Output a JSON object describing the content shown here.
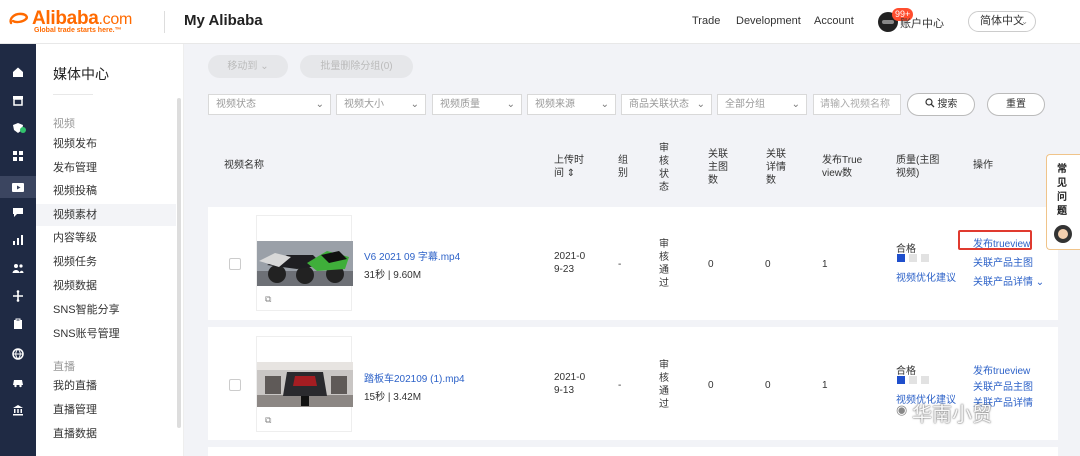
{
  "header": {
    "logo_text": "Alibaba",
    "logo_suffix": ".com",
    "logo_tagline": "Global trade starts here.™",
    "title": "My Alibaba",
    "nav": [
      "Trade",
      "Development",
      "Account"
    ],
    "notification_count": "99+",
    "user_center": "账户中心",
    "language": "简体中文"
  },
  "rail": {
    "icons": [
      "home-icon",
      "store-icon",
      "shield-icon",
      "grid-icon",
      "media-icon",
      "chat-icon",
      "chart-icon",
      "people-icon",
      "share-icon",
      "clipboard-icon",
      "globe-icon",
      "delivery-icon",
      "bank-icon"
    ]
  },
  "sidebar": {
    "title": "媒体中心",
    "group_video": "视频",
    "video_items": [
      "视频发布",
      "发布管理",
      "视频投稿",
      "视频素材",
      "内容等级",
      "视频任务",
      "视频数据",
      "SNS智能分享",
      "SNS账号管理"
    ],
    "group_live": "直播",
    "live_items": [
      "我的直播",
      "直播管理",
      "直播数据"
    ],
    "active_item": "视频素材"
  },
  "toolbar": {
    "move_to": "移动到",
    "batch_delete": "批量删除分组(0)",
    "filters": [
      "视频状态",
      "视频大小",
      "视频质量",
      "视频来源",
      "商品关联状态",
      "全部分组"
    ],
    "search_placeholder": "请输入视频名称",
    "search_button": "搜索",
    "reset_button": "重置"
  },
  "table": {
    "columns": {
      "name": "视频名称",
      "upload_time": "上传时间",
      "group": "组别",
      "review": "审核状态",
      "main_images": "关联主图数",
      "detail_pages": "关联详情数",
      "trueview": "发布True view数",
      "quality": "质量(主图视频)",
      "actions": "操作"
    },
    "rows": [
      {
        "filename": "V6 2021 09 字幕.mp4",
        "meta": "31秒 | 9.60M",
        "date": "2021-09-23",
        "group": "-",
        "review": "审核通过",
        "main_images": "0",
        "detail_pages": "0",
        "trueview": "1",
        "quality": "合格",
        "quality_level": 1,
        "optimize_link": "视频优化建议",
        "action_publish": "发布trueview",
        "action_main": "关联产品主图",
        "action_detail": "关联产品详情"
      },
      {
        "filename": "踏板车202109 (1).mp4",
        "meta": "15秒 | 3.42M",
        "date": "2021-09-13",
        "group": "-",
        "review": "审核通过",
        "main_images": "0",
        "detail_pages": "0",
        "trueview": "1",
        "quality": "合格",
        "quality_level": 1,
        "optimize_link": "视频优化建议",
        "action_publish": "发布trueview",
        "action_main": "关联产品主图",
        "action_detail": "关联产品详情"
      }
    ]
  },
  "faq": "常见问题",
  "watermark": "华南小贸",
  "colors": {
    "brand": "#ff6a00",
    "link": "#2d62c8",
    "highlight": "#e03a2f",
    "rail": "#1f2a44"
  }
}
